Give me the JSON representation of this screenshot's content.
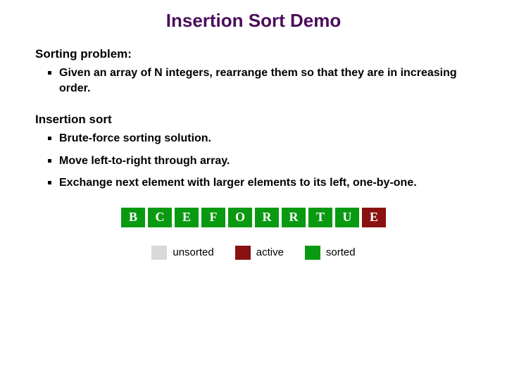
{
  "title": "Insertion Sort Demo",
  "sections": {
    "problem": {
      "heading": "Sorting problem:",
      "bullets": [
        "Given an array of N integers, rearrange them so that they are in increasing order."
      ]
    },
    "insertion": {
      "heading": "Insertion sort",
      "bullets": [
        "Brute-force sorting solution.",
        "Move left-to-right through array.",
        "Exchange next element with larger elements to its left, one-by-one."
      ]
    }
  },
  "array_cells": [
    {
      "letter": "B",
      "state": "sorted"
    },
    {
      "letter": "C",
      "state": "sorted"
    },
    {
      "letter": "E",
      "state": "sorted"
    },
    {
      "letter": "F",
      "state": "sorted"
    },
    {
      "letter": "O",
      "state": "sorted"
    },
    {
      "letter": "R",
      "state": "sorted"
    },
    {
      "letter": "R",
      "state": "sorted"
    },
    {
      "letter": "T",
      "state": "sorted"
    },
    {
      "letter": "U",
      "state": "sorted"
    },
    {
      "letter": "E",
      "state": "active"
    }
  ],
  "legend": {
    "unsorted": "unsorted",
    "active": "active",
    "sorted": "sorted"
  }
}
